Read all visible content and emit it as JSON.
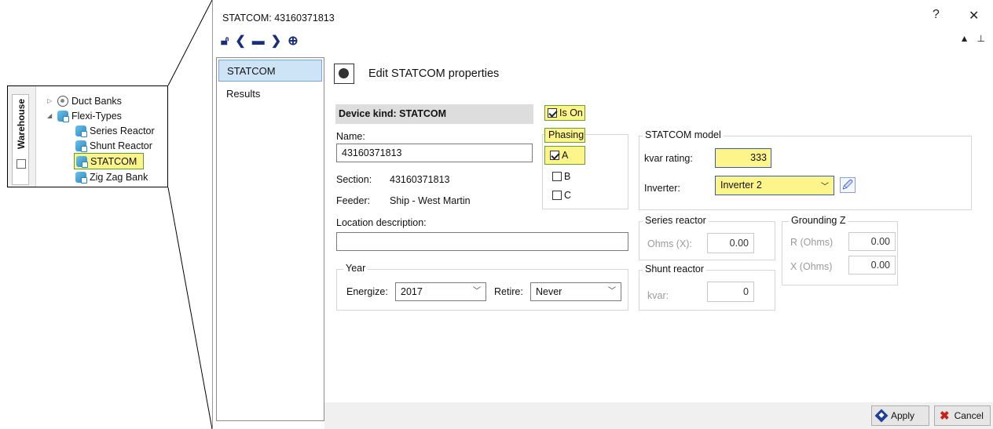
{
  "tree": {
    "warehouse_tab": "Warehouse",
    "items": [
      {
        "label": "Duct Banks"
      },
      {
        "label": "Flexi-Types"
      },
      {
        "label": "Series Reactor"
      },
      {
        "label": "Shunt Reactor"
      },
      {
        "label": "STATCOM"
      },
      {
        "label": "Zig Zag Bank"
      }
    ]
  },
  "dialog": {
    "title": "STATCOM: 43160371813",
    "help_symbol": "?",
    "close_symbol": "✕",
    "nav": [
      {
        "label": "STATCOM"
      },
      {
        "label": "Results"
      }
    ],
    "header": "Edit STATCOM properties"
  },
  "form": {
    "device_kind": "Device kind: STATCOM",
    "name_label": "Name:",
    "name_value": "43160371813",
    "section_label": "Section:",
    "section_value": "43160371813",
    "feeder_label": "Feeder:",
    "feeder_value": "Ship - West Martin",
    "location_label": "Location description:",
    "location_value": "",
    "is_on_label": "Is On",
    "phasing_title": "Phasing",
    "phases": [
      "A",
      "B",
      "C"
    ],
    "year": {
      "title": "Year",
      "energize_label": "Energize:",
      "energize_value": "2017",
      "retire_label": "Retire:",
      "retire_value": "Never"
    },
    "statcom_model": {
      "title": "STATCOM model",
      "kvar_label": "kvar rating:",
      "kvar_value": "333",
      "inverter_label": "Inverter:",
      "inverter_value": "Inverter 2"
    },
    "series_reactor": {
      "title": "Series reactor",
      "ohms_label": "Ohms (X):",
      "ohms_value": "0.00"
    },
    "shunt_reactor": {
      "title": "Shunt reactor",
      "kvar_label": "kvar:",
      "kvar_value": "0"
    },
    "grounding": {
      "title": "Grounding Z",
      "r_label": "R (Ohms)",
      "r_value": "0.00",
      "x_label": "X (Ohms)",
      "x_value": "0.00"
    }
  },
  "footer": {
    "apply": "Apply",
    "cancel": "Cancel"
  },
  "colors": {
    "highlight_yellow": "#fdf48a",
    "nav_selected": "#cde4f7"
  }
}
